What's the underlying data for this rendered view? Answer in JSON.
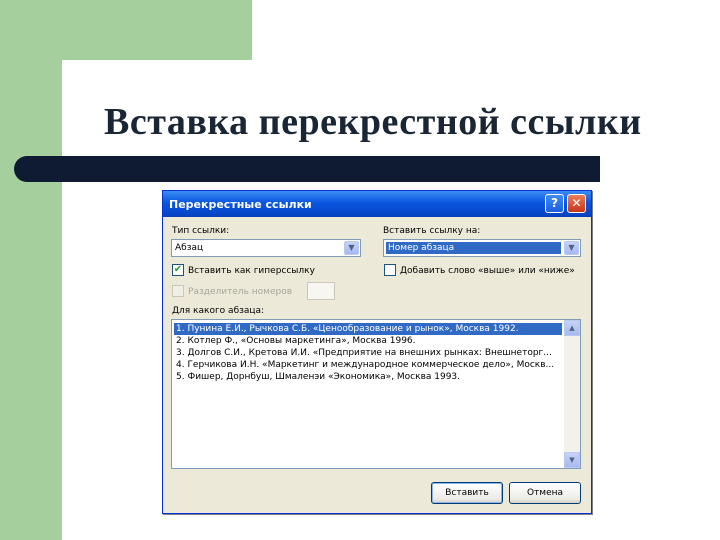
{
  "slide": {
    "title": "Вставка перекрестной ссылки"
  },
  "dialog": {
    "title": "Перекрестные ссылки",
    "help_label": "?",
    "close_label": "✕",
    "link_type_label": "Тип ссылки:",
    "link_type_value": "Абзац",
    "insert_link_label": "Вставить ссылку на:",
    "insert_link_value": "Номер абзаца",
    "insert_as_hyperlink_label": "Вставить как гиперссылку",
    "insert_as_hyperlink_checked": true,
    "add_above_below_label": "Добавить слово «выше» или «ниже»",
    "add_above_below_checked": false,
    "number_separator_label": "Разделитель номеров",
    "which_paragraph_label": "Для какого абзаца:",
    "paragraphs": [
      "1. Пунина Е.И., Рычкова С.Б. «Ценообразование и рынок», Москва 1992.",
      "2. Котлер Ф., «Основы маркетинга», Москва 1996.",
      "3. Долгов С.И., Кретова И.И. «Предприятие на внешних рынках: Внешнеторг...",
      "4. Герчикова И.Н. «Маркетинг и международное коммерческое дело», Москв...",
      "5. Фишер, Дорнбуш, Шмаленэи «Экономика», Москва 1993."
    ],
    "selected_index": 0,
    "insert_button": "Вставить",
    "cancel_button": "Отмена"
  },
  "colors": {
    "slide_green": "#a6cf9e",
    "title_bar": "#0e1b33",
    "dialog_face": "#ece9d8",
    "selection": "#316ac5"
  }
}
